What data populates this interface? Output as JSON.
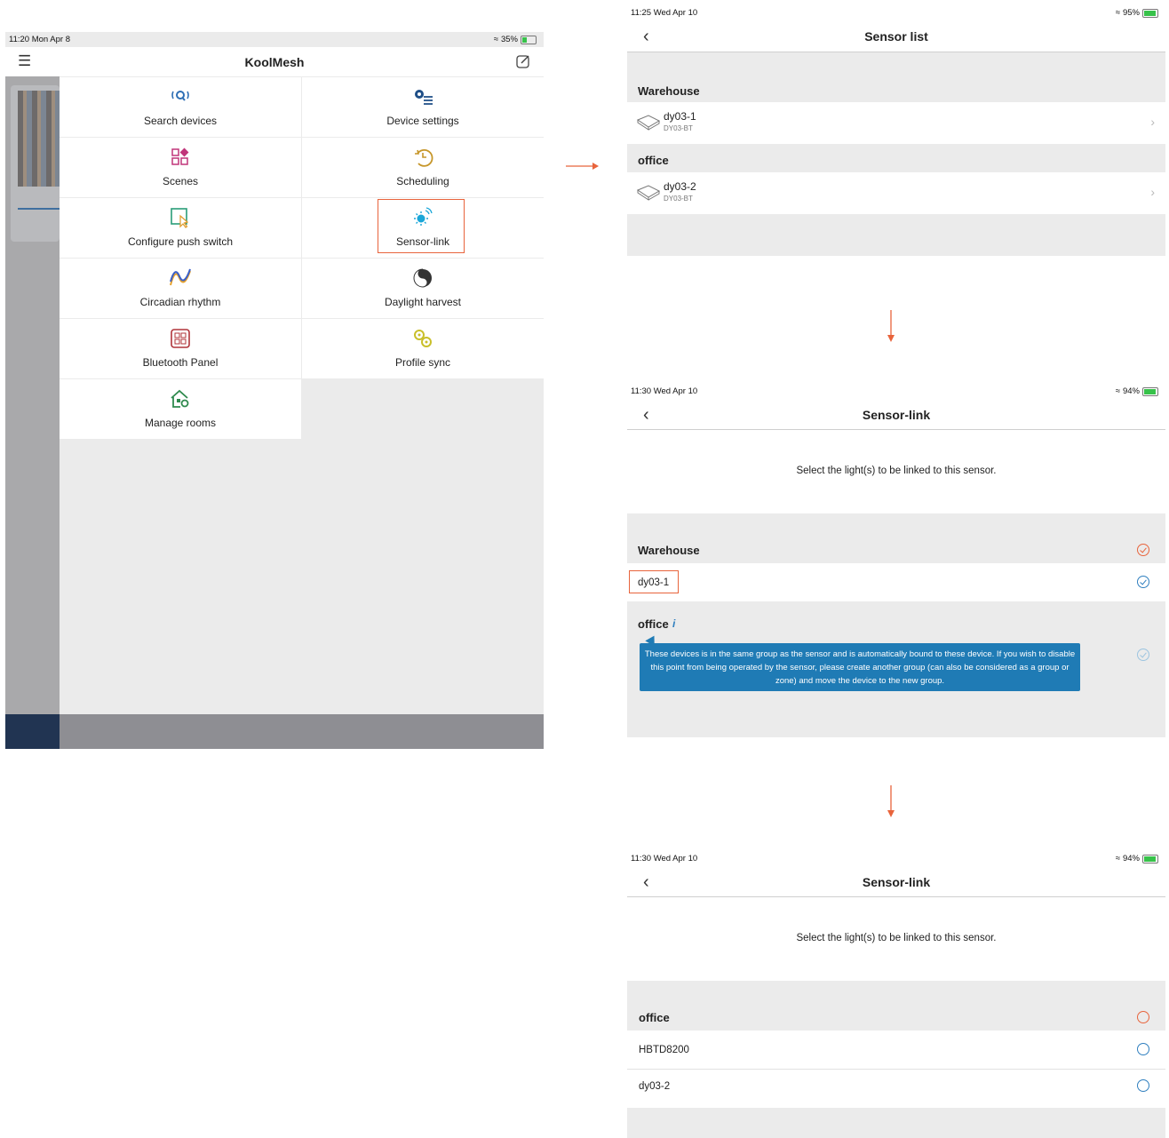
{
  "colors": {
    "accent_orange": "#e8643c",
    "blue": "#2f7fbf",
    "tooltip_bg": "#1f7bb5",
    "gray_bg": "#ebebeb"
  },
  "left": {
    "status_time": "11:20  Mon Apr 8",
    "battery": "35%",
    "title": "KoolMesh",
    "menu": {
      "search_devices": "Search devices",
      "device_settings": "Device settings",
      "scenes": "Scenes",
      "scheduling": "Scheduling",
      "configure_push_switch": "Configure push switch",
      "sensor_link": "Sensor-link",
      "circadian_rhythm": "Circadian rhythm",
      "daylight_harvest": "Daylight harvest",
      "bluetooth_panel": "Bluetooth Panel",
      "profile_sync": "Profile sync",
      "manage_rooms": "Manage rooms"
    }
  },
  "sensor_list": {
    "status_time": "11:25  Wed Apr 10",
    "battery": "95%",
    "title": "Sensor list",
    "group1": "Warehouse",
    "item1_name": "dy03-1",
    "item1_model": "DY03-BT",
    "group2": "office",
    "item2_name": "dy03-2",
    "item2_model": "DY03-BT"
  },
  "sensor_link_1": {
    "status_time": "11:30  Wed Apr 10",
    "battery": "94%",
    "title": "Sensor-link",
    "instruction": "Select the light(s) to be linked to this sensor.",
    "group1": "Warehouse",
    "item1": "dy03-1",
    "group2": "office",
    "tooltip": "These devices is in the same group as the sensor and is automatically bound to these device.  If you wish to disable this point from being operated by the sensor, please create another group (can also be considered as a group or zone) and move the device to the new group."
  },
  "sensor_link_2": {
    "status_time": "11:30  Wed Apr 10",
    "battery": "94%",
    "title": "Sensor-link",
    "instruction": "Select the light(s) to be linked to this sensor.",
    "group1": "office",
    "item1": "HBTD8200",
    "item2": "dy03-2"
  }
}
